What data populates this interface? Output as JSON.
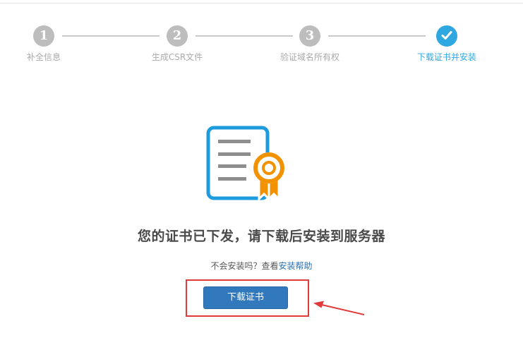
{
  "steps": [
    {
      "number": "1",
      "label": "补全信息",
      "state": "done"
    },
    {
      "number": "2",
      "label": "生成CSR文件",
      "state": "done"
    },
    {
      "number": "3",
      "label": "验证域名所有权",
      "state": "done"
    },
    {
      "number": "",
      "label": "下载证书并安装",
      "state": "active"
    }
  ],
  "colors": {
    "step_gray": "#bdbdbd",
    "step_active": "#2fa7e0",
    "button": "#3278bd",
    "annotation": "#e13a3a",
    "icon_blue": "#1e9bdc",
    "icon_orange": "#f39200"
  },
  "icons": {
    "active_step": "check-icon",
    "illustration": "certificate-icon",
    "annotation": "red-arrow-icon"
  },
  "main": {
    "headline": "您的证书已下发，请下载后安装到服务器",
    "help_prefix": "不会安装吗？查看",
    "help_link": "安装帮助",
    "download_button": "下载证书"
  }
}
